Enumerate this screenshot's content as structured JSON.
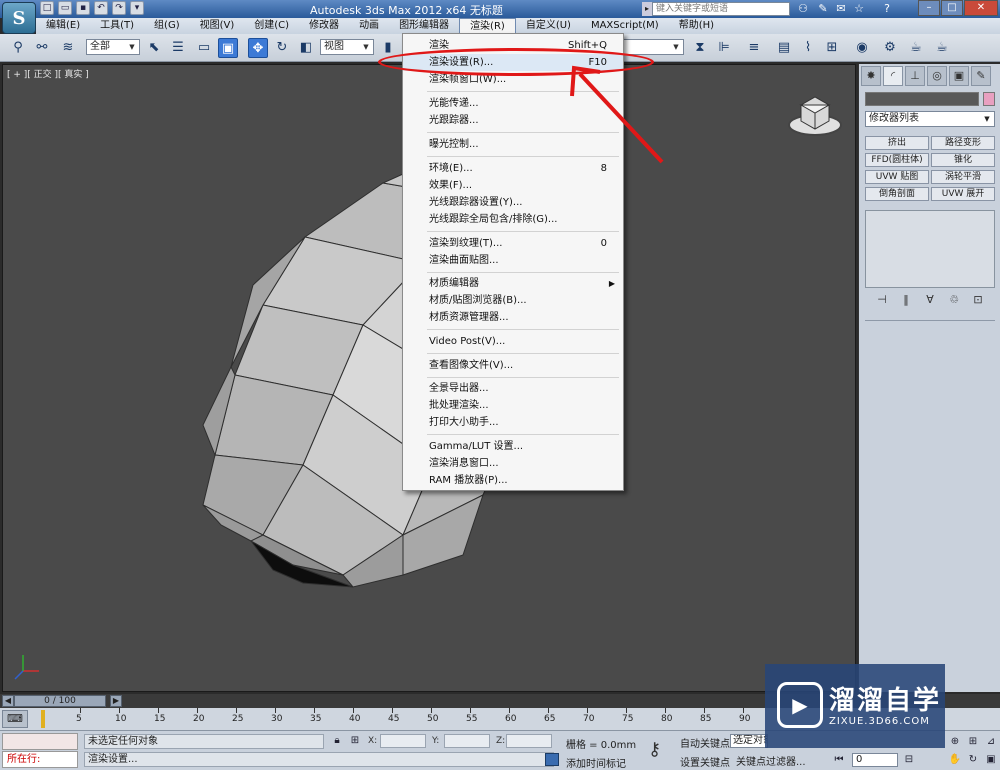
{
  "titlebar": {
    "app_title": "Autodesk 3ds Max  2012 x64      无标题",
    "search_placeholder": "键入关键字或短语",
    "logo_glyph": "S",
    "qa_icons": [
      "new-icon",
      "open-icon",
      "save-icon",
      "undo-icon",
      "redo-icon",
      "dropdown-icon"
    ]
  },
  "menubar": {
    "items": [
      {
        "label": "编辑(E)"
      },
      {
        "label": "工具(T)"
      },
      {
        "label": "组(G)"
      },
      {
        "label": "视图(V)"
      },
      {
        "label": "创建(C)"
      },
      {
        "label": "修改器"
      },
      {
        "label": "动画"
      },
      {
        "label": "图形编辑器"
      },
      {
        "label": "渲染(R)"
      },
      {
        "label": "自定义(U)"
      },
      {
        "label": "MAXScript(M)"
      },
      {
        "label": "帮助(H)"
      }
    ]
  },
  "toolbar": {
    "selection_filter": "全部",
    "ref_coord": "视图"
  },
  "viewport": {
    "label": "[ + ][ 正交 ][ 真实 ]"
  },
  "render_menu": {
    "items": [
      {
        "label": "渲染",
        "shortcut": "Shift+Q"
      },
      {
        "label": "渲染设置(R)...",
        "shortcut": "F10"
      },
      {
        "label": "渲染帧窗口(W)...",
        "shortcut": ""
      },
      {
        "label": "光能传递...",
        "shortcut": ""
      },
      {
        "label": "光跟踪器...",
        "shortcut": ""
      },
      {
        "label": "曝光控制...",
        "shortcut": ""
      },
      {
        "label": "环境(E)...",
        "shortcut": "8"
      },
      {
        "label": "效果(F)...",
        "shortcut": ""
      },
      {
        "label": "光线跟踪器设置(Y)...",
        "shortcut": ""
      },
      {
        "label": "光线跟踪全局包含/排除(G)...",
        "shortcut": ""
      },
      {
        "label": "渲染到纹理(T)...",
        "shortcut": "0"
      },
      {
        "label": "渲染曲面贴图...",
        "shortcut": ""
      },
      {
        "label": "材质编辑器",
        "shortcut": ""
      },
      {
        "label": "材质/贴图浏览器(B)...",
        "shortcut": ""
      },
      {
        "label": "材质资源管理器...",
        "shortcut": ""
      },
      {
        "label": "Video Post(V)...",
        "shortcut": ""
      },
      {
        "label": "查看图像文件(V)...",
        "shortcut": ""
      },
      {
        "label": "全景导出器...",
        "shortcut": ""
      },
      {
        "label": "批处理渲染...",
        "shortcut": ""
      },
      {
        "label": "打印大小助手...",
        "shortcut": ""
      },
      {
        "label": "Gamma/LUT 设置...",
        "shortcut": ""
      },
      {
        "label": "渲染消息窗口...",
        "shortcut": ""
      },
      {
        "label": "RAM 播放器(P)...",
        "shortcut": ""
      }
    ]
  },
  "command_panel": {
    "modifier_list": "修改器列表",
    "buttons": [
      "挤出",
      "路径变形",
      "FFD(圆柱体)",
      "锥化",
      "UVW 贴图",
      "涡轮平滑",
      "倒角剖面",
      "UVW 展开"
    ]
  },
  "timeline": {
    "frame_counter": "0 / 100",
    "ticks": [
      "5",
      "10",
      "15",
      "20",
      "25",
      "30",
      "35",
      "40",
      "45",
      "50",
      "55",
      "60",
      "65",
      "70",
      "75",
      "80",
      "85",
      "90"
    ]
  },
  "statusbar": {
    "maxscript_out": "所在行:",
    "status_line1": "未选定任何对象",
    "status_line2": "渲染设置...",
    "x_label": "X:",
    "y_label": "Y:",
    "z_label": "Z:",
    "grid": "栅格 = 0.0mm",
    "add_tag": "添加时间标记",
    "auto_key": "自动关键点",
    "set_key": "设置关键点",
    "selection_dropdown": "选定对象",
    "key_filters": "关键点过滤器...",
    "frame": "0"
  },
  "watermark": {
    "name": "溜溜自学",
    "url": "ZIXUE.3D66.COM"
  },
  "colors": {
    "highlight_red": "#e01818",
    "viewport_bg": "#4a4a4a",
    "menu_highlight": "#dce8f5"
  }
}
